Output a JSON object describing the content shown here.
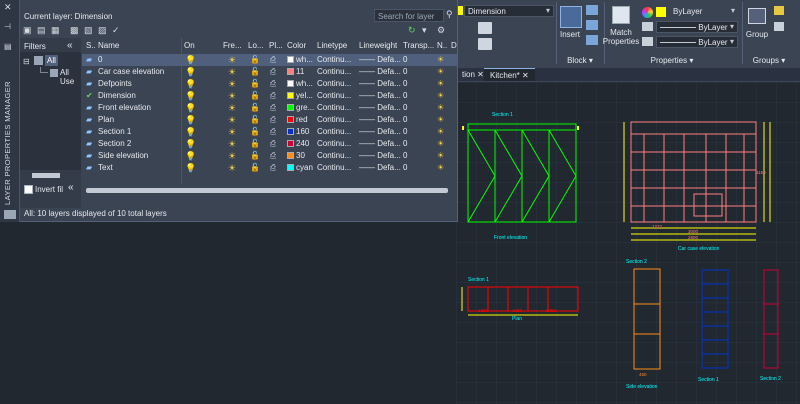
{
  "palette": {
    "title": "LAYER PROPERTIES MANAGER",
    "current_layer": "Current layer: Dimension",
    "search_placeholder": "Search for layer",
    "filters_label": "Filters",
    "collapse_icon": "«",
    "tree_all": "All",
    "tree_all_used": "All Use",
    "invert_filter": "Invert fil",
    "status": "All: 10 layers displayed of 10 total layers",
    "columns": {
      "s": "S..",
      "name": "Name",
      "on": "On",
      "freeze": "Fre...",
      "lock": "Lo...",
      "plot": "Pl...",
      "color": "Color",
      "linetype": "Linetype",
      "lineweight": "Lineweight",
      "transp": "Transp...",
      "n": "N..",
      "d": "D"
    },
    "layers": [
      {
        "name": "0",
        "color_name": "wh...",
        "color_hex": "#ffffff",
        "linetype": "Continu...",
        "lineweight": "—— Defa...",
        "transp": "0",
        "selected": true
      },
      {
        "name": "Car case elevation",
        "color_name": "11",
        "color_hex": "#ff7f7f",
        "linetype": "Continu...",
        "lineweight": "—— Defa...",
        "transp": "0"
      },
      {
        "name": "Defpoints",
        "color_name": "wh...",
        "color_hex": "#ffffff",
        "linetype": "Continu...",
        "lineweight": "—— Defa...",
        "transp": "0"
      },
      {
        "name": "Dimension",
        "color_name": "yel...",
        "color_hex": "#ffff00",
        "linetype": "Continu...",
        "lineweight": "—— Defa...",
        "transp": "0",
        "current": true
      },
      {
        "name": "Front elevation",
        "color_name": "gre...",
        "color_hex": "#00ff00",
        "linetype": "Continu...",
        "lineweight": "—— Defa...",
        "transp": "0"
      },
      {
        "name": "Plan",
        "color_name": "red",
        "color_hex": "#ff0000",
        "linetype": "Continu...",
        "lineweight": "—— Defa...",
        "transp": "0"
      },
      {
        "name": "Section 1",
        "color_name": "160",
        "color_hex": "#0033cc",
        "linetype": "Continu...",
        "lineweight": "—— Defa...",
        "transp": "0"
      },
      {
        "name": "Section 2",
        "color_name": "240",
        "color_hex": "#cc0033",
        "linetype": "Continu...",
        "lineweight": "—— Defa...",
        "transp": "0"
      },
      {
        "name": "Side elevation",
        "color_name": "30",
        "color_hex": "#ff8c1a",
        "linetype": "Continu...",
        "lineweight": "—— Defa...",
        "transp": "0"
      },
      {
        "name": "Text",
        "color_name": "cyan",
        "color_hex": "#00ffff",
        "linetype": "Continu...",
        "lineweight": "—— Defa...",
        "transp": "0"
      }
    ]
  },
  "ribbon": {
    "layer_dropdown": "Dimension",
    "insert_label": "Insert",
    "block_label": "Block",
    "match_properties_label": "Match\nProperties",
    "bylayer_color": "ByLayer",
    "bylayer_linetype": "ByLayer",
    "bylayer_lineweight": "ByLayer",
    "properties_label": "Properties",
    "group_label": "Group",
    "groups_label": "Groups"
  },
  "doc_tabs": {
    "partial_tab": "tion",
    "kitchen_tab": "Kitchen*"
  },
  "drawing": {
    "front_title": "Section 1",
    "front_caption": "Front elevation",
    "carcase_caption": "Car case elevation",
    "carcase_dims": [
      "1222",
      "3000",
      "1150",
      "2800"
    ],
    "plan_title": "Section 1",
    "plan_caption": "Plan",
    "plan_dims": [
      "1350",
      "1350",
      "1350"
    ],
    "side_title": "Section 2",
    "side_caption": "Side elevation",
    "side_dim": "450",
    "sec1_caption": "Section 1",
    "sec2_caption": "Section 2",
    "sec1_title": "Section 1",
    "sec2_title": "Section 2"
  },
  "colors": {
    "bg": "#212830",
    "panel": "#3b4453",
    "selected_row": "#50607c",
    "accent_cyan": "#00ffff"
  }
}
